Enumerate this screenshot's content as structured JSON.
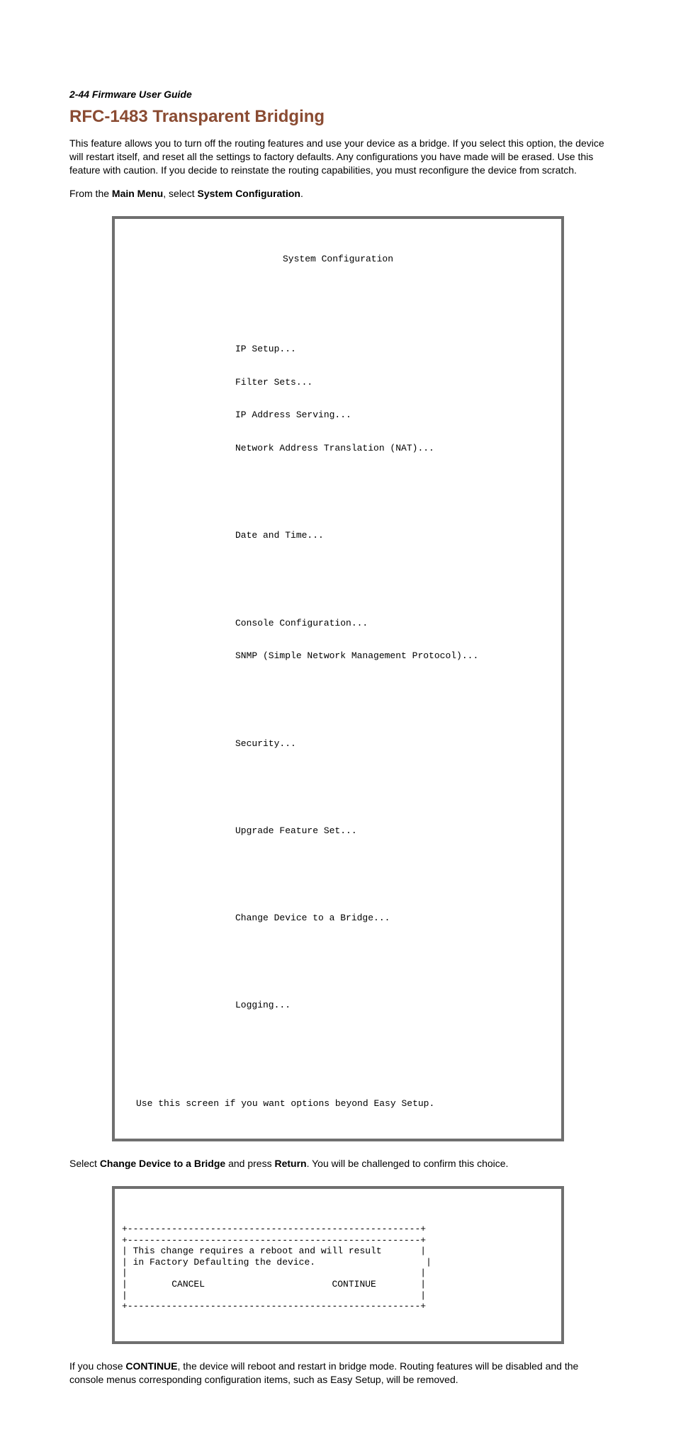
{
  "header": "2-44  Firmware User Guide",
  "title": "RFC-1483 Transparent Bridging",
  "intro": "This feature allows you to turn off the routing features and use your device as a bridge. If you select this option, the device will restart itself, and reset all the settings to factory defaults. Any configurations you have made will be erased. Use this feature with caution. If you decide to reinstate the routing capabilities, you must reconfigure the device from scratch.",
  "nav_line": {
    "prefix": "From the ",
    "bold1": "Main Menu",
    "mid": ", select ",
    "bold2": "System Configuration",
    "suffix": "."
  },
  "terminal1": {
    "title": "System Configuration",
    "group1": [
      "IP Setup...",
      "Filter Sets...",
      "IP Address Serving...",
      "Network Address Translation (NAT)..."
    ],
    "group2": [
      "Date and Time..."
    ],
    "group3": [
      "Console Configuration...",
      "SNMP (Simple Network Management Protocol)..."
    ],
    "group4": [
      "Security..."
    ],
    "group5": [
      "Upgrade Feature Set..."
    ],
    "group6": [
      "Change Device to a Bridge..."
    ],
    "group7": [
      "Logging..."
    ],
    "footer": "Use this screen if you want options beyond Easy Setup."
  },
  "mid_line": {
    "prefix": "Select ",
    "bold1": "Change Device to a Bridge",
    "mid1": " and press ",
    "bold2": "Return",
    "suffix": ". You will be challenged to confirm this choice."
  },
  "dialog": {
    "top": "+-----------------------------------------------------+",
    "msg1": "| This change requires a reboot and will result       |",
    "msg2": "| in Factory Defaulting the device.                    |",
    "blank": "|                                                     |",
    "btns": "|        CANCEL                       CONTINUE        |",
    "bot": "+-----------------------------------------------------+"
  },
  "closing": {
    "prefix": "If you chose ",
    "bold1": "CONTINUE",
    "suffix": ", the device will reboot and restart in bridge mode. Routing features will be disabled and the console menus corresponding configuration items, such as Easy Setup, will be removed."
  }
}
